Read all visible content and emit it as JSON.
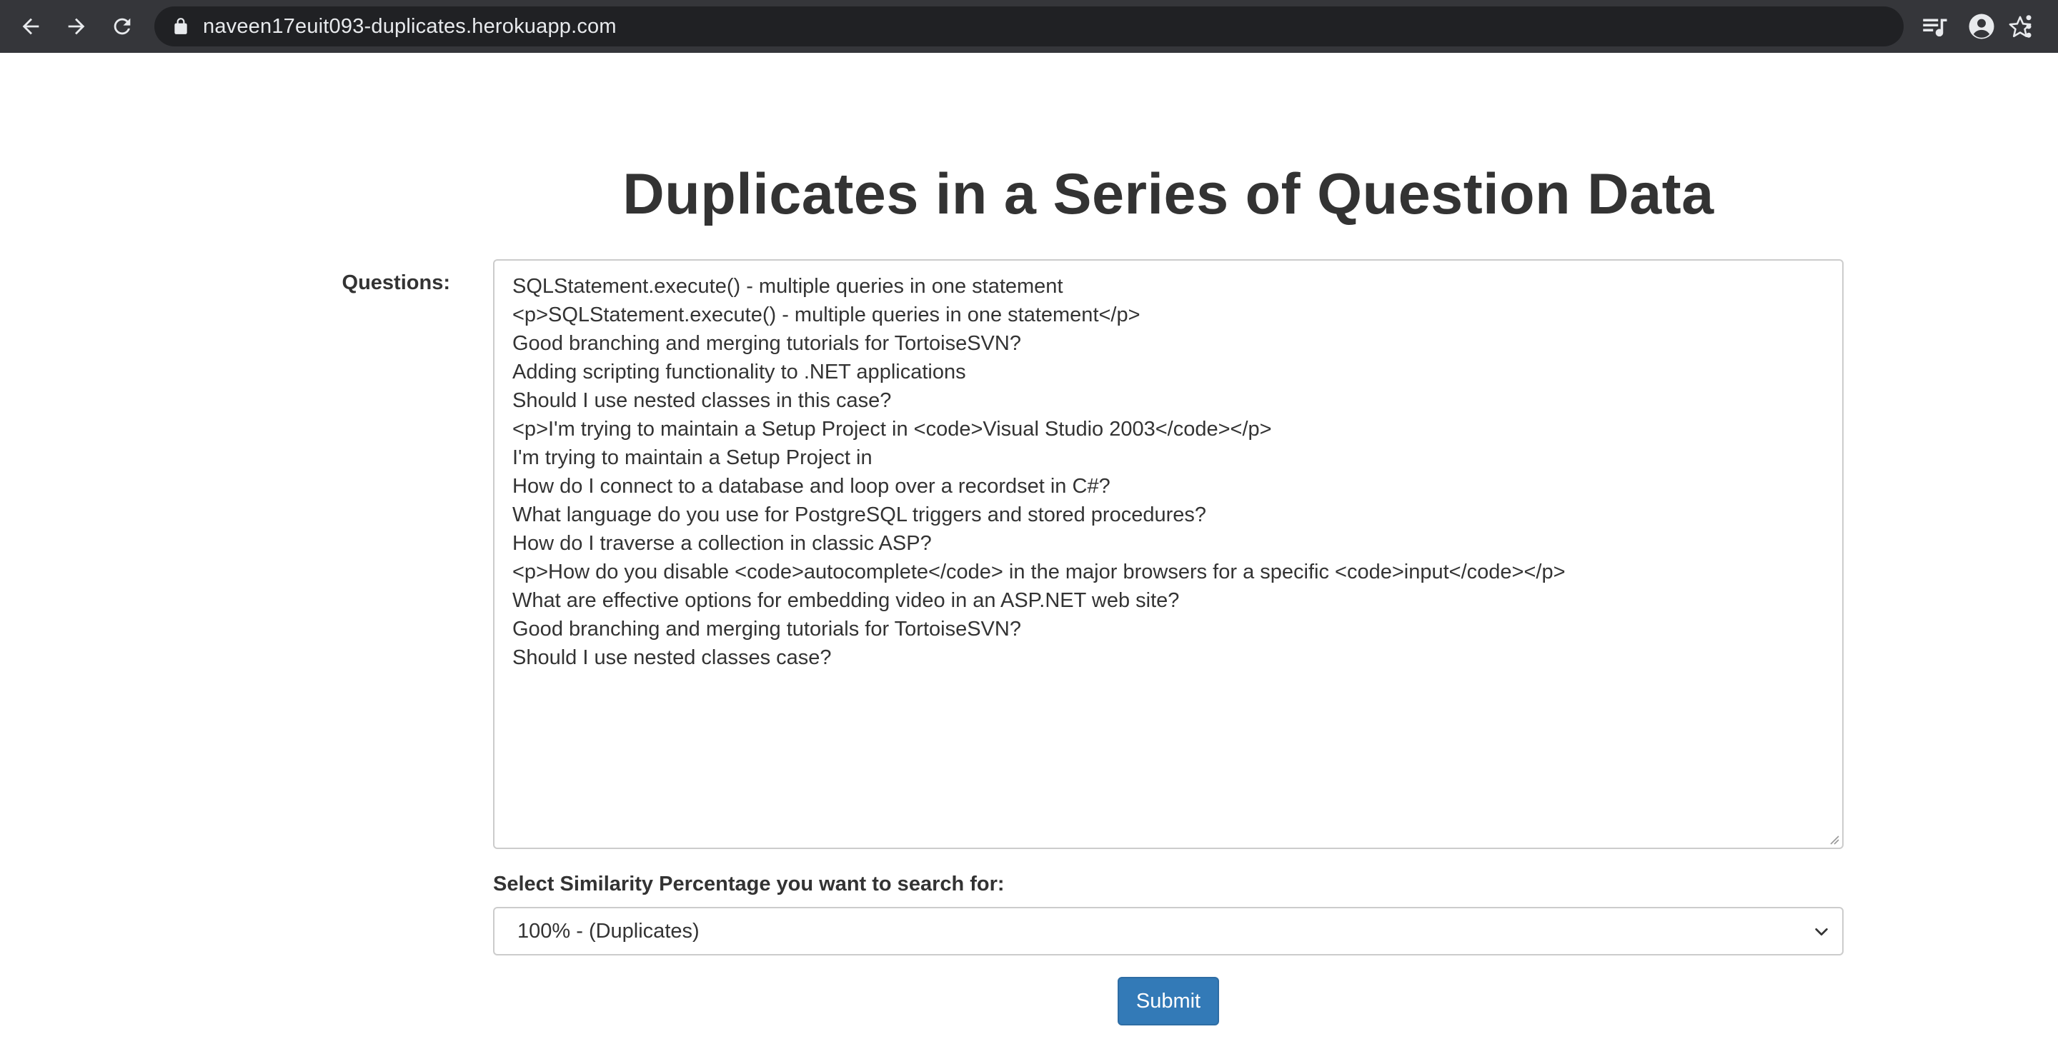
{
  "browser": {
    "url": "naveen17euit093-duplicates.herokuapp.com"
  },
  "page": {
    "title": "Duplicates in a Series of Question Data",
    "questions_label": "Questions:",
    "questions": [
      "SQLStatement.execute() - multiple queries in one statement",
      "<p>SQLStatement.execute() - multiple queries in one statement</p>",
      "Good branching and merging tutorials for TortoiseSVN?",
      "Adding scripting functionality to .NET applications",
      "Should I use nested classes in this case?",
      "<p>I'm trying to maintain a Setup Project in <code>Visual Studio 2003</code></p>",
      "I'm trying to maintain a Setup Project in",
      "How do I connect to a database and loop over a recordset in C#?",
      "What language do you use for PostgreSQL triggers and stored procedures?",
      "How do I traverse a collection in classic ASP?",
      "<p>How do you disable <code>autocomplete</code> in the major browsers for a specific <code>input</code></p>",
      "What are effective options for embedding video in an ASP.NET web site?",
      "Good branching and merging tutorials for TortoiseSVN?",
      "Should I use nested classes case?"
    ],
    "similarity_label": "Select Similarity Percentage you want to search for:",
    "similarity_selected": "100% - (Duplicates)",
    "submit_label": "Submit"
  },
  "colors": {
    "chrome_bg": "#35363a",
    "omnibox_bg": "#202124",
    "text": "#333333",
    "button": "#337ab7"
  },
  "icons": [
    "back-icon",
    "forward-icon",
    "reload-icon",
    "lock-icon",
    "star-icon",
    "media-queue-icon",
    "profile-icon",
    "more-menu-icon",
    "chevron-down-icon",
    "resize-grip-icon"
  ]
}
